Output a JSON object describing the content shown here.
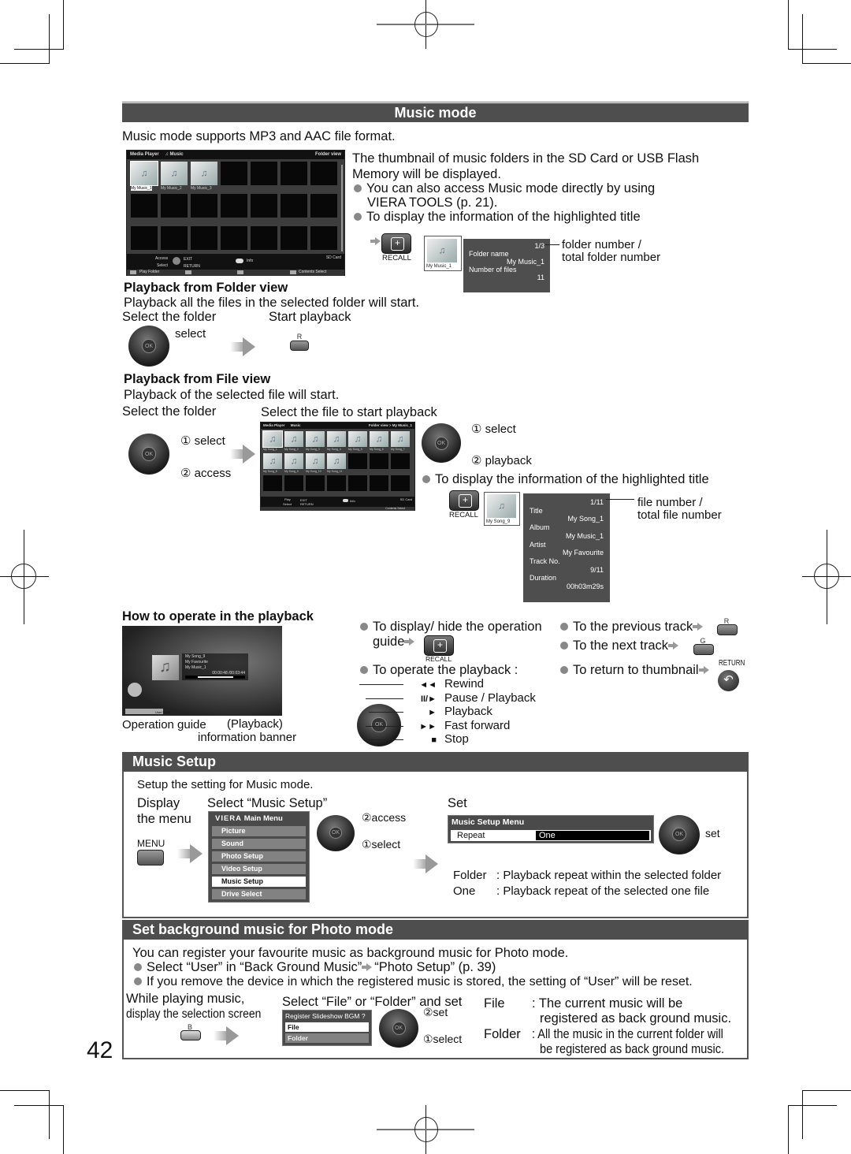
{
  "page_number": "42",
  "music_mode": {
    "title": "Music mode",
    "intro": "Music mode supports MP3 and AAC file format.",
    "folder_screen": {
      "app": "Media Player",
      "mode": "Music",
      "view": "Folder view",
      "folders": [
        "My Music_1",
        "My Music_2",
        "My Music_3"
      ],
      "access": "Access",
      "select": "Select",
      "exit": "EXIT",
      "return": "RETURN",
      "info": "Info",
      "device": "SD Card",
      "play_folder": "Play Folder",
      "contents_select": "Contents Select"
    },
    "desc_line1": "The thumbnail of music folders in the SD Card or USB Flash",
    "desc_line2": "Memory will be displayed.",
    "bullet1_line1": "You can also access Music mode directly by using",
    "bullet1_line2": "VIERA TOOLS (p. 21).",
    "bullet2": "To display the information of the highlighted title",
    "recall_label": "RECALL",
    "folder_info": {
      "thumb_label": "My Music_1",
      "counter": "1/3",
      "folder_name_label": "Folder name",
      "folder_name": "My Music_1",
      "files_label": "Number of files",
      "files": "11"
    },
    "folder_counter_note_1": "folder number /",
    "folder_counter_note_2": "total folder number",
    "playback_folder": {
      "heading": "Playback from Folder view",
      "desc": "Playback all the files in the selected folder will start.",
      "step1": "Select the folder",
      "step2": "Start playback",
      "select": "select",
      "button": "R"
    },
    "playback_file": {
      "heading": "Playback from File view",
      "desc": "Playback of the selected file will start.",
      "step1": "Select the folder",
      "step2": "Select the file to start playback",
      "select1": "① select",
      "access": "② access",
      "select2": "① select",
      "playback": "② playback",
      "bullet": "To display the information of the highlighted title"
    },
    "file_screen": {
      "app": "Media Player",
      "mode": "Music",
      "view": "Folder view > My Music_1",
      "files": [
        "My Song_1",
        "My Song_2",
        "My Song_3",
        "My Song_4",
        "My Song_5",
        "My Song_6",
        "My Song_7",
        "My Song_8",
        "My Song_9",
        "My Song_10",
        "My Song_11"
      ],
      "play": "Play",
      "select": "Select",
      "exit": "EXIT",
      "return": "RETURN",
      "info": "Info",
      "device": "SD Card",
      "contents_select": "Contents Select"
    },
    "file_info": {
      "thumb_label": "My Song_9",
      "counter": "1/11",
      "rows": [
        {
          "label": "Title",
          "value": "My Song_1"
        },
        {
          "label": "Album",
          "value": "My Music_1"
        },
        {
          "label": "Artist",
          "value": "My Favourite"
        },
        {
          "label": "Track No.",
          "value": "9/11"
        },
        {
          "label": "Duration",
          "value": "00h03m29s"
        }
      ]
    },
    "file_counter_note_1": "file number /",
    "file_counter_note_2": "total file number",
    "operate": {
      "heading": "How to operate in the playback",
      "banner": {
        "song": "My Song_9",
        "artist": "My Favourite",
        "album": "My Music_1",
        "time": "00:00:48 /00:03:44",
        "progress": 0.22,
        "user_bgm": "User BGM"
      },
      "caption_guide": "Operation guide",
      "caption_banner_1": "(Playback)",
      "caption_banner_2": "information banner",
      "b1_line1": "To display/ hide the operation",
      "b1_line2": "guide",
      "b2": "To operate the playback :",
      "controls": [
        {
          "glyph": "◄◄",
          "label": "Rewind"
        },
        {
          "glyph": "II/►",
          "label": "Pause / Playback"
        },
        {
          "glyph": "►",
          "label": "Playback"
        },
        {
          "glyph": "►►",
          "label": "Fast forward"
        },
        {
          "glyph": "■",
          "label": "Stop"
        }
      ],
      "prev": "To the previous track",
      "prev_btn": "R",
      "next": "To the next track",
      "next_btn": "G",
      "thumb": "To return to thumbnail",
      "return_label": "RETURN"
    }
  },
  "music_setup": {
    "title": "Music Setup",
    "intro": "Setup the setting for Music mode.",
    "step1_line1": "Display",
    "step1_line2": "the menu",
    "menu_btn": "MENU",
    "step2": "Select “Music Setup”",
    "main_menu": {
      "title": "Main Menu",
      "brand": "VIERA",
      "items": [
        "Picture",
        "Sound",
        "Photo Setup",
        "Video Setup",
        "Music Setup",
        "Drive Select"
      ],
      "selected": "Music Setup"
    },
    "access": "②access",
    "select": "①select",
    "step3": "Set",
    "setup_menu": {
      "title": "Music Setup Menu",
      "label": "Repeat",
      "value": "One"
    },
    "set": "set",
    "options": [
      {
        "name": "Folder",
        "desc": ": Playback repeat within the selected folder"
      },
      {
        "name": "One",
        "desc": ": Playback repeat of the selected one file"
      }
    ]
  },
  "bgm": {
    "title": "Set background music for Photo mode",
    "intro": "You can register your favourite music as background music for Photo mode.",
    "bullet1_a": "Select “User” in “Back Ground Music”",
    "bullet1_b": "“Photo Setup” (p. 39)",
    "bullet2": "If you remove the device in which the registered music is stored, the setting of “User” will be reset.",
    "step1_line1": "While playing music,",
    "step1_line2": "display the selection screen",
    "button": "B",
    "step2": "Select “File” or “Folder” and set",
    "dialog": {
      "title": "Register Slideshow BGM ?",
      "options": [
        "File",
        "Folder"
      ],
      "selected": "File"
    },
    "set": "②set",
    "select": "①select",
    "options": [
      {
        "name": "File",
        "desc1": ": The current music will be",
        "desc2": "registered as back ground music."
      },
      {
        "name": "Folder",
        "desc1": ": All the music in the current folder will",
        "desc2": "be registered as back ground music."
      }
    ]
  }
}
